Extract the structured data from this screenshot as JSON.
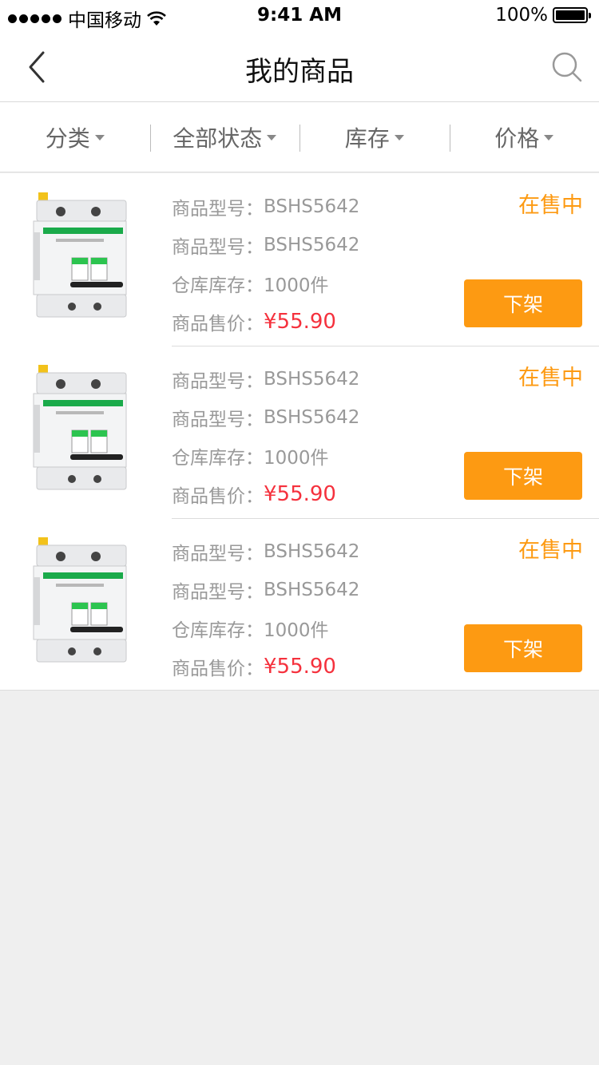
{
  "status_bar": {
    "carrier": "中国移动",
    "time": "9:41 AM",
    "battery": "100%"
  },
  "nav": {
    "title": "我的商品",
    "back_icon": "chevron-left-icon",
    "search_icon": "search-icon"
  },
  "filters": [
    {
      "label": "分类"
    },
    {
      "label": "全部状态"
    },
    {
      "label": "库存"
    },
    {
      "label": "价格"
    }
  ],
  "colors": {
    "accent": "#fd9a12",
    "price": "#f5313d"
  },
  "products": [
    {
      "model_label": "商品型号：",
      "model": "BSHS5642",
      "model2_label": "商品型号：",
      "model2": "BSHS5642",
      "stock_label": "仓库库存：",
      "stock": "1000件",
      "price_label": "商品售价：",
      "price": "¥55.90",
      "status": "在售中",
      "action": "下架"
    },
    {
      "model_label": "商品型号：",
      "model": "BSHS5642",
      "model2_label": "商品型号：",
      "model2": "BSHS5642",
      "stock_label": "仓库库存：",
      "stock": "1000件",
      "price_label": "商品售价：",
      "price": "¥55.90",
      "status": "在售中",
      "action": "下架"
    },
    {
      "model_label": "商品型号：",
      "model": "BSHS5642",
      "model2_label": "商品型号：",
      "model2": "BSHS5642",
      "stock_label": "仓库库存：",
      "stock": "1000件",
      "price_label": "商品售价：",
      "price": "¥55.90",
      "status": "在售中",
      "action": "下架"
    }
  ]
}
